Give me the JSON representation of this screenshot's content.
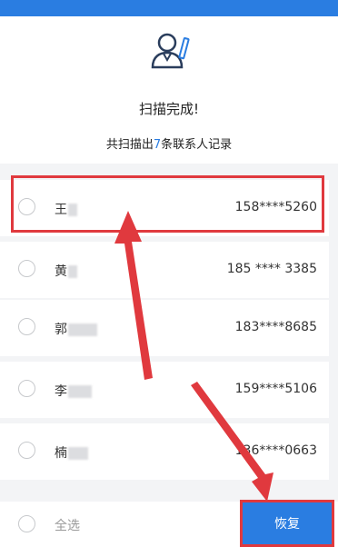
{
  "header": {
    "title": "扫描完成!",
    "subtitle_prefix": "共扫描出",
    "subtitle_count": "7",
    "subtitle_suffix": "条联系人记录"
  },
  "contacts": [
    {
      "name": "王",
      "phone": "158****5260"
    },
    {
      "name": "黄",
      "phone": "185 **** 3385"
    },
    {
      "name": "郭",
      "phone": "183****8685"
    },
    {
      "name": "李",
      "phone": "159****5106"
    },
    {
      "name": "楠",
      "phone": "136****0663"
    }
  ],
  "footer": {
    "select_all": "全选",
    "restore": "恢复"
  },
  "colors": {
    "accent": "#2a7de1",
    "annotation": "#e0393e"
  }
}
